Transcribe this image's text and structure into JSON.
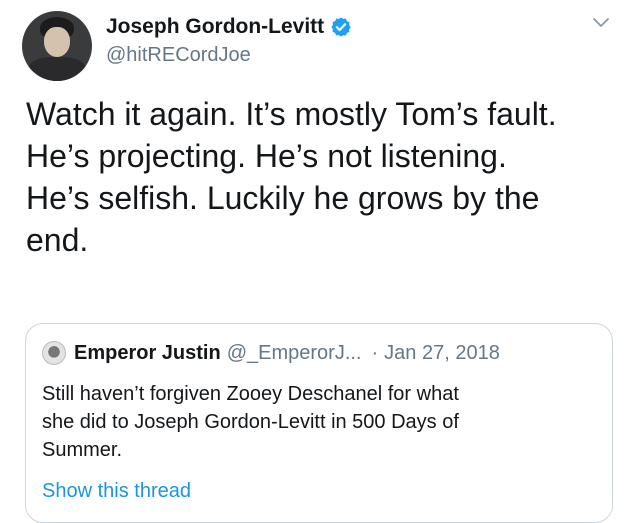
{
  "tweet": {
    "author_name": "Joseph Gordon-Levitt",
    "author_handle": "@hitRECordJoe",
    "verified": true,
    "text_lines": [
      "Watch it again. It’s mostly Tom’s fault.",
      "He’s projecting. He’s not listening.",
      "He’s selfish. Luckily he grows by the",
      "end."
    ],
    "icons": {
      "menu": "chevron-down-icon",
      "verified": "verified-badge-icon"
    }
  },
  "quoted_tweet": {
    "author_name": "Emperor Justin",
    "author_handle": "@_EmperorJ...",
    "separator": "·",
    "date": "Jan 27, 2018",
    "text_lines": [
      "Still haven’t forgiven Zooey Deschanel for what",
      "she did to Joseph Gordon-Levitt in 500 Days of",
      "Summer."
    ],
    "link_text": "Show this thread"
  },
  "colors": {
    "text": "#14171a",
    "secondary": "#657786",
    "link": "#1b95e0",
    "verified": "#1da1f2",
    "border": "#ccd6dd"
  }
}
